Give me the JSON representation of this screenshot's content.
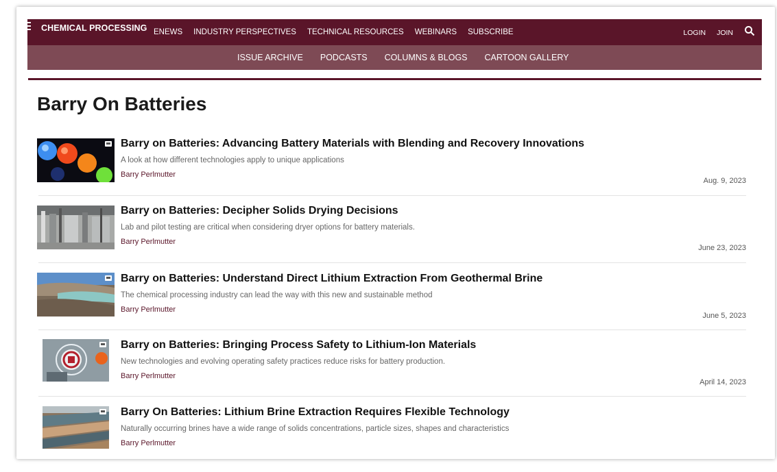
{
  "header": {
    "logo": "CHEMICAL PROCESSING",
    "nav": [
      "ENEWS",
      "INDUSTRY PERSPECTIVES",
      "TECHNICAL RESOURCES",
      "WEBINARS",
      "SUBSCRIBE"
    ],
    "login": "LOGIN",
    "join": "JOIN",
    "brand_color": "#5a1529"
  },
  "subnav": [
    "ISSUE ARCHIVE",
    "PODCASTS",
    "COLUMNS & BLOGS",
    "CARTOON GALLERY"
  ],
  "page_title": "Barry On Batteries",
  "articles": [
    {
      "title": "Barry on Batteries: Advancing Battery Materials with Blending and Recovery Innovations",
      "description": "A look at how different technologies apply to unique applications",
      "author": "Barry Perlmutter",
      "date": "Aug. 9, 2023",
      "thumb": "glowing-colored-pellets"
    },
    {
      "title": "Barry on Batteries: Decipher Solids Drying Decisions",
      "description": "Lab and pilot testing are critical when considering dryer options for battery materials.",
      "author": "Barry Perlmutter",
      "date": "June 23, 2023",
      "thumb": "industrial-dryer-equipment"
    },
    {
      "title": "Barry on Batteries: Understand Direct Lithium Extraction From Geothermal Brine",
      "description": "The chemical processing industry can lead the way with this new and sustainable method",
      "author": "Barry Perlmutter",
      "date": "June 5, 2023",
      "thumb": "brine-pond-landscape"
    },
    {
      "title": "Barry on Batteries: Bringing Process Safety to Lithium-Ion Materials",
      "description": "New technologies and evolving operating safety practices reduce risks for battery production.",
      "author": "Barry Perlmutter",
      "date": "April 14, 2023",
      "thumb": "safety-icon-overlay"
    },
    {
      "title": "Barry On Batteries: Lithium Brine Extraction Requires Flexible Technology",
      "description": "Naturally occurring brines have a wide range of solids concentrations, particle sizes, shapes and characteristics",
      "author": "Barry Perlmutter",
      "date": "",
      "thumb": "aerial-brine-fields"
    }
  ]
}
